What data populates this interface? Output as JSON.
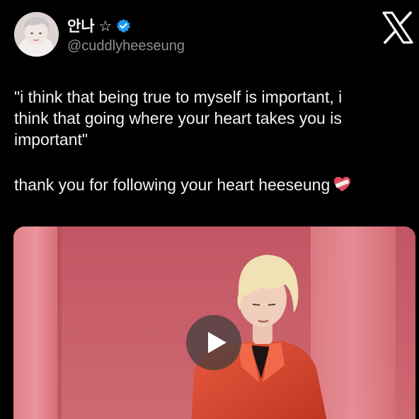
{
  "author": {
    "display_name": "안나 ☆",
    "handle": "@cuddlyheeseung",
    "verified_color": "#1d9bf0"
  },
  "platform": {
    "logo_icon": "x-logo-icon"
  },
  "tweet": {
    "lines": [
      "\"i think that being true to myself is important, i",
      "think that going where your heart takes you is",
      "important\""
    ],
    "closing_line": "thank you for following your heart heeseung",
    "emoji": "mending-heart-icon"
  },
  "media": {
    "type": "video",
    "play_icon": "play-icon",
    "background_color": "#c9606a",
    "jacket_color": "#d6402a"
  }
}
